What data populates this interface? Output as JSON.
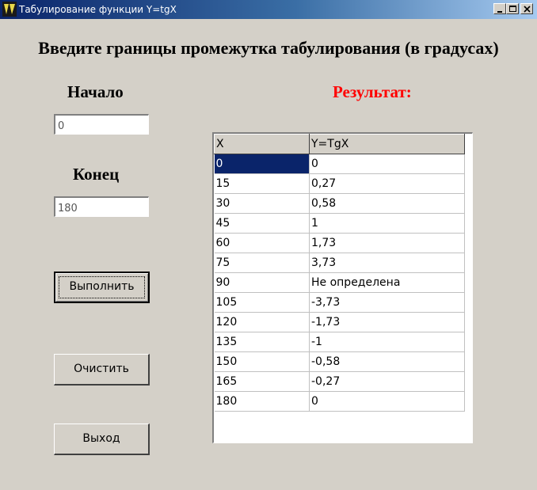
{
  "window": {
    "title": "Табулирование функции Y=tgX",
    "icon": "delphi-app-icon",
    "controls": [
      "minimize-icon",
      "maximize-icon",
      "close-icon"
    ]
  },
  "heading": "Введите границы промежутка табулирования (в градусах)",
  "start": {
    "label": "Начало",
    "value": "0"
  },
  "end": {
    "label": "Конец",
    "value": "180"
  },
  "result_label": "Результат:",
  "buttons": {
    "run": "Выполнить",
    "clear": "Очистить",
    "exit": "Выход"
  },
  "table": {
    "headers": [
      "X",
      "Y=TgX"
    ],
    "rows": [
      [
        "0",
        "0"
      ],
      [
        "15",
        "0,27"
      ],
      [
        "30",
        "0,58"
      ],
      [
        "45",
        "1"
      ],
      [
        "60",
        "1,73"
      ],
      [
        "75",
        "3,73"
      ],
      [
        "90",
        "Не определена"
      ],
      [
        "105",
        "-3,73"
      ],
      [
        "120",
        "-1,73"
      ],
      [
        "135",
        "-1"
      ],
      [
        "150",
        "-0,58"
      ],
      [
        "165",
        "-0,27"
      ],
      [
        "180",
        "0"
      ]
    ],
    "selected_row": 0
  },
  "colors": {
    "title_bar": "#0a246a",
    "result_label": "#ff0000",
    "window_bg": "#d4d0c8",
    "selection": "#0a246a"
  }
}
